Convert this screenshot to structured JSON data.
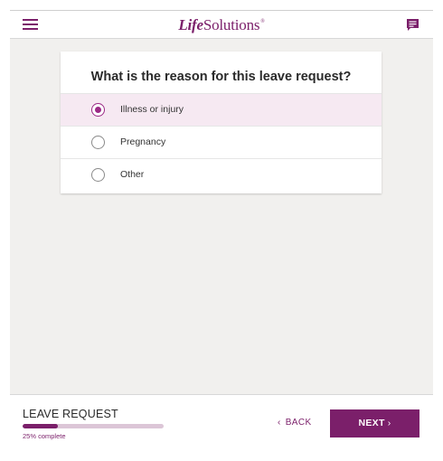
{
  "header": {
    "logo_bold": "Life",
    "logo_rest": "Solutions",
    "logo_mark": "®",
    "menu_icon": "hamburger-menu-icon",
    "chat_icon": "chat-bubble-icon"
  },
  "question": {
    "text": "What is the reason for this leave request?",
    "options": [
      {
        "label": "Illness or injury",
        "selected": true
      },
      {
        "label": "Pregnancy",
        "selected": false
      },
      {
        "label": "Other",
        "selected": false
      }
    ]
  },
  "footer": {
    "title": "LEAVE REQUEST",
    "progress_percent": 25,
    "progress_text": "25% complete",
    "back_label": "BACK",
    "next_label": "NEXT",
    "back_chevron": "‹",
    "next_chevron": "›"
  },
  "colors": {
    "brand": "#7b1f6a",
    "selected_bg": "#f6e9f2",
    "radio_accent": "#9b2a86",
    "progress_track": "#dcc6d7",
    "main_bg": "#f1f0ee"
  }
}
